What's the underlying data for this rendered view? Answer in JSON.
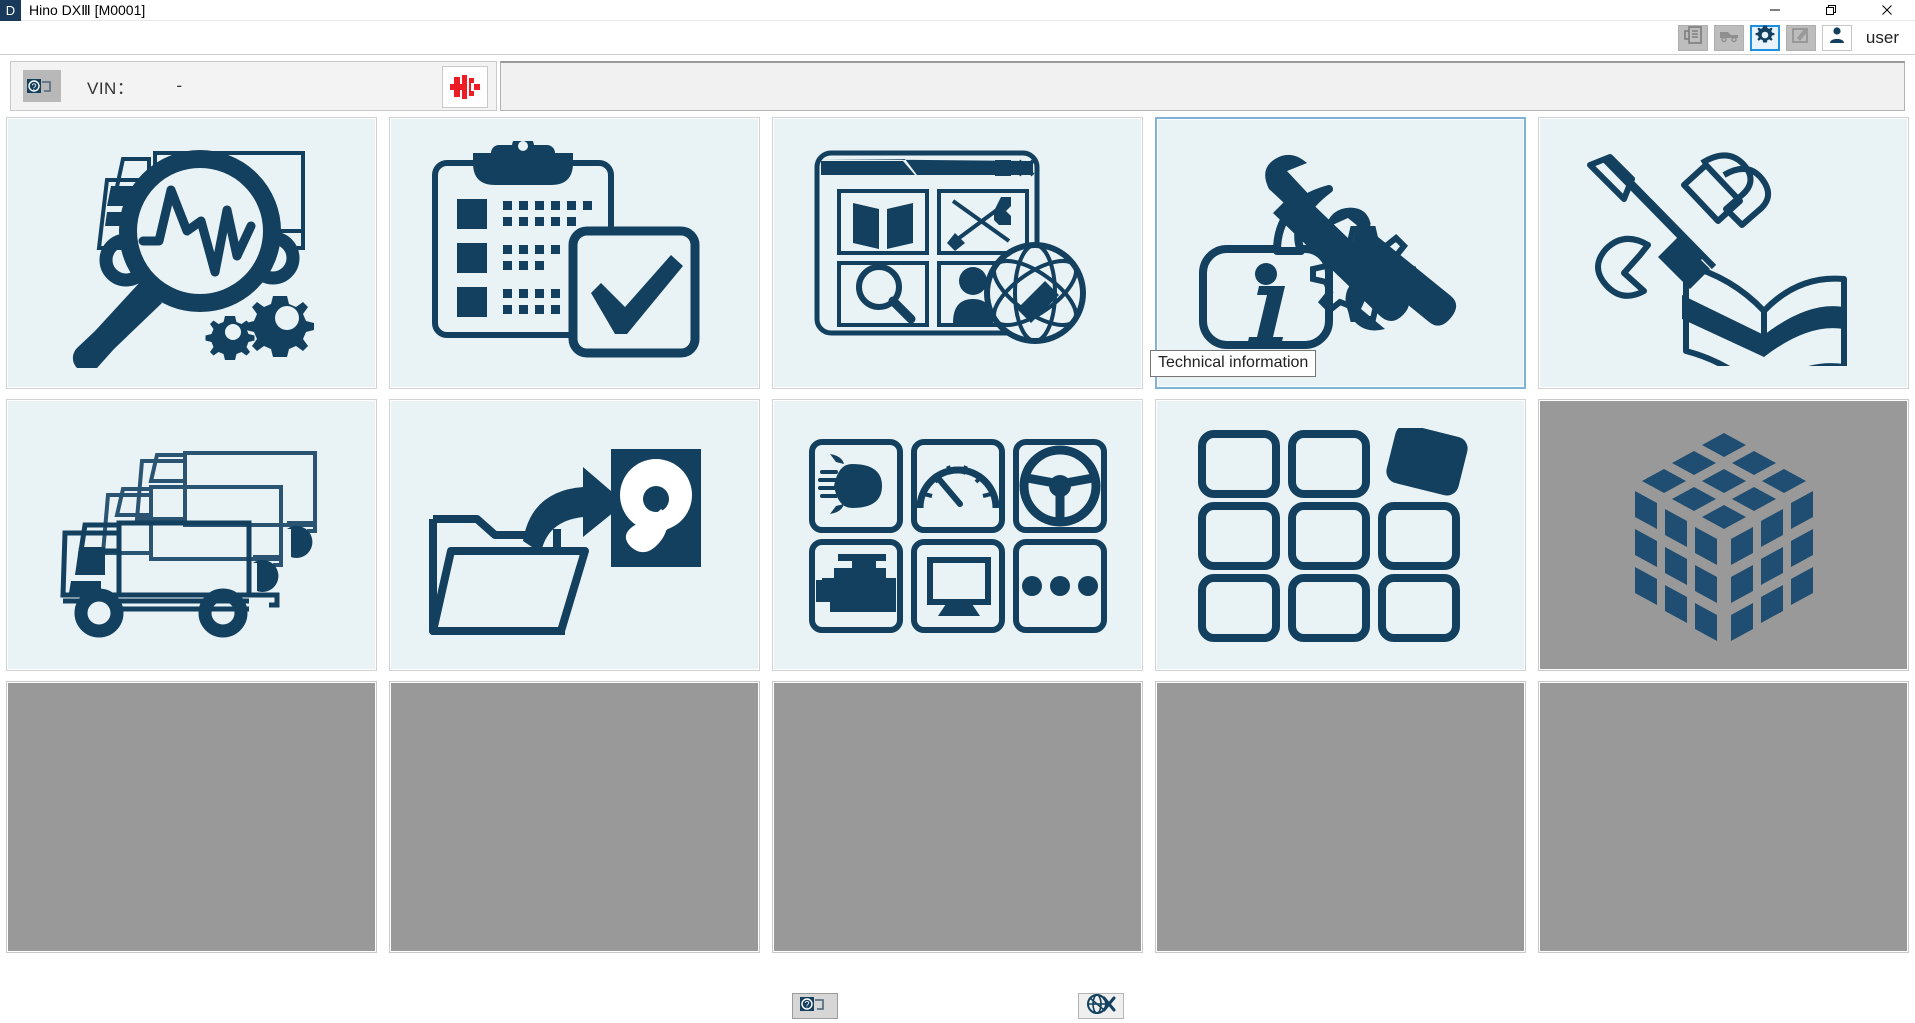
{
  "window": {
    "app_badge": "D",
    "title": "Hino DXⅢ [M0001]",
    "minimize_label": "—",
    "restore_label": "❐",
    "close_label": "✕"
  },
  "toolbar": {
    "buttons": [
      {
        "name": "report-icon",
        "tooltip": "Report",
        "state": "normal"
      },
      {
        "name": "vehicle-icon",
        "tooltip": "Vehicle",
        "state": "normal"
      },
      {
        "name": "gear-icon",
        "tooltip": "Settings",
        "state": "active"
      },
      {
        "name": "edit-icon",
        "tooltip": "Edit",
        "state": "normal"
      },
      {
        "name": "user-icon",
        "tooltip": "User",
        "state": "user"
      }
    ],
    "user_name": "user"
  },
  "vin_bar": {
    "connector_icon": "connector-query-icon",
    "label": "VIN：",
    "value": "-",
    "red_button_icon": "connector-disconnected-icon"
  },
  "tiles": [
    {
      "id": "diagnostics",
      "icon": "truck-magnifier-gears-icon",
      "state": "enabled"
    },
    {
      "id": "inspection-checklist",
      "icon": "clipboard-check-icon",
      "state": "enabled"
    },
    {
      "id": "web-portal",
      "icon": "browser-globe-icon",
      "state": "enabled"
    },
    {
      "id": "technical-information",
      "icon": "info-wrench-gear-icon",
      "state": "selected"
    },
    {
      "id": "service-manual",
      "icon": "tools-book-icon",
      "state": "enabled"
    },
    {
      "id": "vehicle-selection",
      "icon": "three-trucks-icon",
      "state": "enabled"
    },
    {
      "id": "data-backup",
      "icon": "folder-arrow-harddisk-icon",
      "state": "enabled"
    },
    {
      "id": "ecu-functions",
      "icon": "six-panel-functions-icon",
      "state": "enabled"
    },
    {
      "id": "module-grid",
      "icon": "grid-detached-tile-icon",
      "state": "enabled"
    },
    {
      "id": "data-cube",
      "icon": "isometric-cube-icon",
      "state": "disabled"
    },
    {
      "id": "empty-1",
      "icon": "",
      "state": "empty"
    },
    {
      "id": "empty-2",
      "icon": "",
      "state": "empty"
    },
    {
      "id": "empty-3",
      "icon": "",
      "state": "empty"
    },
    {
      "id": "empty-4",
      "icon": "",
      "state": "empty"
    },
    {
      "id": "empty-5",
      "icon": "",
      "state": "empty"
    }
  ],
  "tooltip": {
    "text": "Technical information"
  },
  "bottom_bar": {
    "buttons": [
      {
        "name": "connector-query-icon",
        "tooltip": "Connection"
      },
      {
        "name": "globe-disconnect-icon",
        "tooltip": "Offline"
      }
    ]
  },
  "colors": {
    "brand_dark": "#13405e",
    "tile_bg": "#e9f3f5",
    "tile_disabled": "#999999",
    "accent_blue": "#1b8fe0",
    "selected_border": "#7fb4d8",
    "red": "#ee1c25"
  }
}
